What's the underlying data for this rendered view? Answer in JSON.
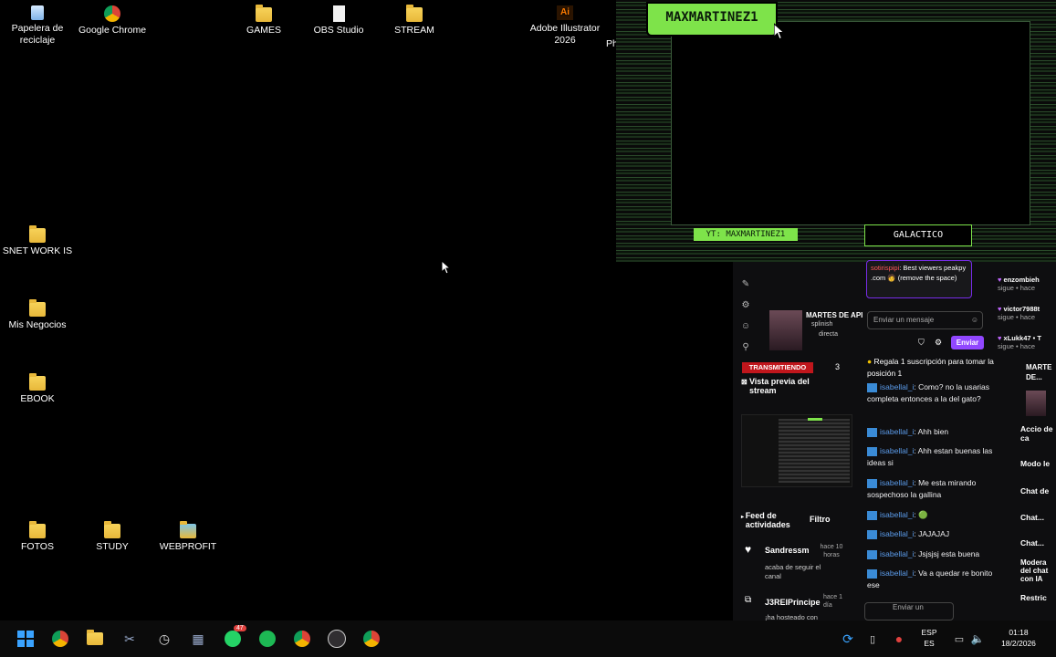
{
  "desktop": {
    "icons": [
      {
        "label": "Papelera de reciclaje"
      },
      {
        "label": "Google Chrome"
      },
      {
        "label": "GAMES"
      },
      {
        "label": "OBS Studio"
      },
      {
        "label": "STREAM"
      },
      {
        "label": "Adobe Illustrator 2026"
      },
      {
        "label": "Ph"
      },
      {
        "label": "SNET WORK IS"
      },
      {
        "label": "Mis Negocios"
      },
      {
        "label": "EBOOK"
      },
      {
        "label": "FOTOS"
      },
      {
        "label": "STUDY"
      },
      {
        "label": "WEBPROFIT"
      }
    ]
  },
  "overlay": {
    "name": "MAXMARTINEZ1",
    "yt": "YT: MAXMARTINEZ1",
    "galactico": "GALACTICO"
  },
  "stream_panel": {
    "top_chat": {
      "user": "sotirispipi",
      "text": ": Best viewers peakpy .com 🧑 (remove the space)"
    },
    "chat_input_placeholder": "Enviar un mensaje",
    "send_label": "Enviar",
    "preview_title": "MARTES DE API",
    "preview_sub1": "splinish",
    "preview_sub2": "directa",
    "transmitting_label": "TRANSMITIENDO",
    "transmitting_count": "3",
    "stream_preview_label": "Vista previa del stream",
    "activity_feed_label": "Feed de actividades",
    "filter_label": "Filtro",
    "events": [
      {
        "user": "Sandressm",
        "time": "hace 10 horas",
        "desc": "acaba de seguir el canal"
      },
      {
        "user": "J3REIPrincipe",
        "time": "hace 1 día",
        "desc": "¡ha hosteado con"
      }
    ],
    "sub_banner": "Regala 1 suscripción para tomar la posición 1",
    "chat": [
      {
        "user": "isabellal_i",
        "text": ": Como? no la usarias completa entonces a la del gato?"
      },
      {
        "user": "isabellal_i",
        "text": ": Ahh bien"
      },
      {
        "user": "isabellal_i",
        "text": ": Ahh estan buenas las ideas si"
      },
      {
        "user": "isabellal_i",
        "text": ": Me esta mirando sospechoso la gallina"
      },
      {
        "user": "isabellal_i",
        "text": ": 🟢"
      },
      {
        "user": "isabellal_i",
        "text": ": JAJAJAJ"
      },
      {
        "user": "isabellal_i",
        "text": ": Jsjsjsj esta buena"
      },
      {
        "user": "isabellal_i",
        "text": ": Va a quedar re bonito ese"
      }
    ],
    "bottom_input": "Enviar un",
    "right_events": [
      {
        "user": "enzombieh",
        "text": "sigue • hace"
      },
      {
        "user": "victor7988t",
        "text": "sigue • hace"
      },
      {
        "user": "xLukk47 • T",
        "text": "sigue • hace"
      }
    ],
    "right_title": "MARTE DE...",
    "side_actions": [
      "Accio de ca",
      "Modo le",
      "Chat de",
      "Chat...",
      "Chat...",
      "Modera del chat con IA",
      "Restric"
    ]
  },
  "taskbar": {
    "lang_top": "ESP",
    "lang_bottom": "ES",
    "time": "01:18",
    "date": "18/2/2026",
    "whatsapp_badge": "47"
  }
}
